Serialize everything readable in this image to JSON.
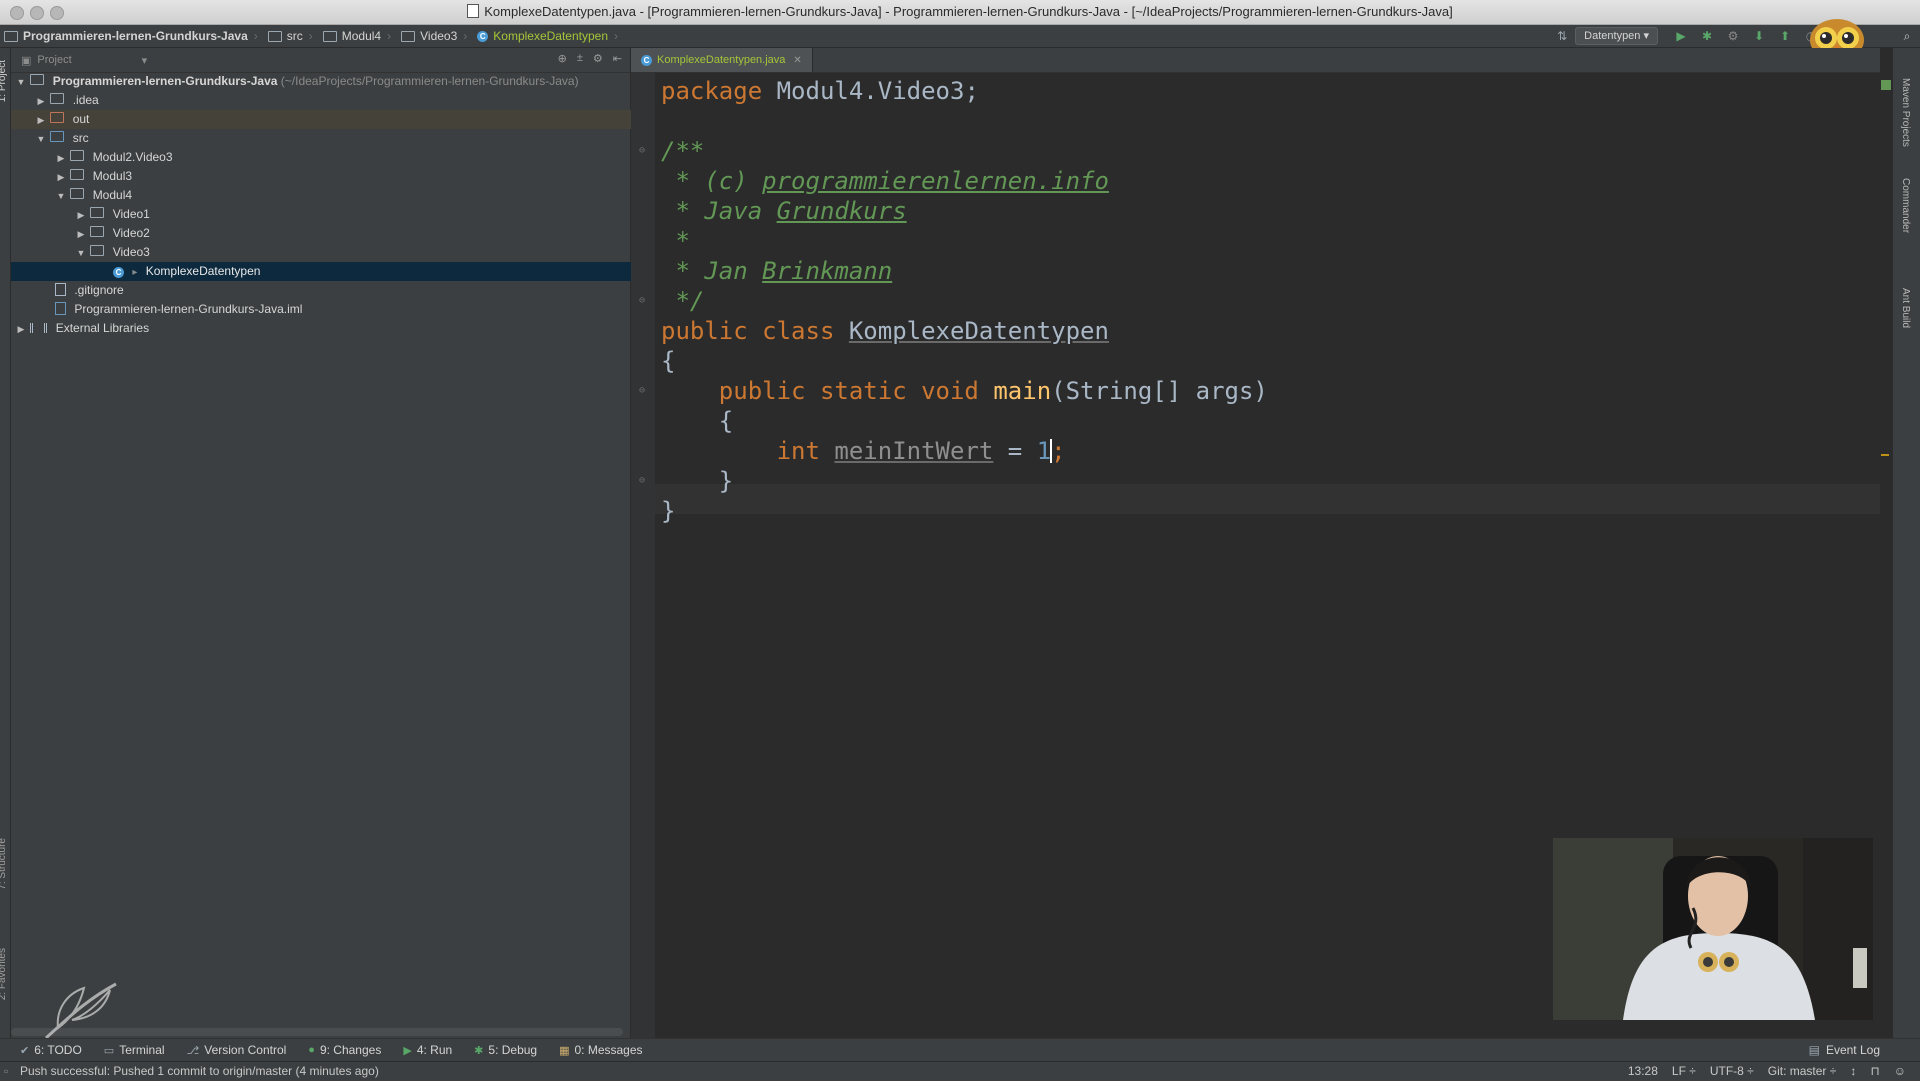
{
  "window": {
    "title": "KomplexeDatentypen.java - [Programmieren-lernen-Grundkurs-Java] - Programmieren-lernen-Grundkurs-Java - [~/IdeaProjects/Programmieren-lernen-Grundkurs-Java]"
  },
  "navbar": {
    "breadcrumbs": [
      "Programmieren-lernen-Grundkurs-Java",
      "src",
      "Modul4",
      "Video3",
      "KomplexeDatentypen"
    ],
    "run_config": "Datentypen"
  },
  "project_panel": {
    "header": "Project",
    "root": {
      "name": "Programmieren-lernen-Grundkurs-Java",
      "path_hint": "(~/IdeaProjects/Programmieren-lernen-Grundkurs-Java)"
    },
    "items": [
      {
        "label": ".idea"
      },
      {
        "label": "out"
      },
      {
        "label": "src"
      },
      {
        "label": "Modul2.Video3"
      },
      {
        "label": "Modul3"
      },
      {
        "label": "Modul4"
      },
      {
        "label": "Video1"
      },
      {
        "label": "Video2"
      },
      {
        "label": "Video3"
      },
      {
        "label": "KomplexeDatentypen"
      },
      {
        "label": ".gitignore"
      },
      {
        "label": "Programmieren-lernen-Grundkurs-Java.iml"
      },
      {
        "label": "External Libraries"
      }
    ]
  },
  "editor": {
    "tab_label": "KomplexeDatentypen.java",
    "code": {
      "l1_kw": "package",
      "l1_rest": " Modul4.Video3;",
      "l3": "/**",
      "l4_pre": " * (c) ",
      "l4_link": "programmierenlernen.info",
      "l5_pre": " * Java ",
      "l5_link": "Grundkurs",
      "l6": " *",
      "l7_pre": " * Jan ",
      "l7_link": "Brinkmann",
      "l8": " */",
      "l9_kw": "public class",
      "l9_name": "KomplexeDatentypen",
      "l10": "{",
      "l11_kw": "public static void",
      "l11_fn": "main",
      "l11_rest": "(String[] args)",
      "l12": "{",
      "l13_kw": "int",
      "l13_var": "meinIntWert",
      "l13_eq": " = ",
      "l13_num": "1",
      "l13_semi": ";",
      "l14": "}",
      "l15": "}"
    }
  },
  "right_strip": {
    "tabs": [
      "Maven Projects",
      "Commander",
      "Ant Build"
    ]
  },
  "left_strip": {
    "tabs": [
      "1: Project",
      "7: Structure",
      "2: Favorites"
    ]
  },
  "toolbar": {
    "items": [
      {
        "label": "6: TODO"
      },
      {
        "label": "Terminal"
      },
      {
        "label": "Version Control"
      },
      {
        "label": "9: Changes"
      },
      {
        "label": "4: Run"
      },
      {
        "label": "5: Debug"
      },
      {
        "label": "0: Messages"
      }
    ],
    "event_log": "Event Log"
  },
  "status": {
    "message": "Push successful: Pushed 1 commit to origin/master (4 minutes ago)",
    "position": "13:28",
    "line_sep": "LF ÷",
    "encoding": "UTF-8 ÷",
    "vcs": "Git: master ÷"
  },
  "colors": {
    "editor_bg": "#2b2b2b",
    "keyword": "#cc7832",
    "comment": "#629755",
    "function": "#ffc66d",
    "number": "#6897bb",
    "selection": "#0d293e"
  }
}
